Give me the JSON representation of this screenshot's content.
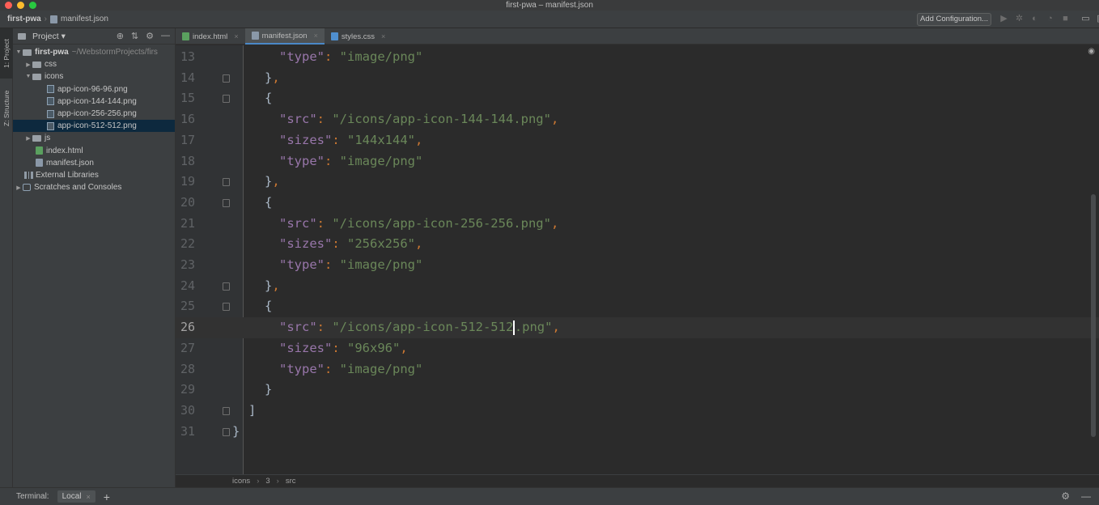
{
  "window": {
    "title": "first-pwa – manifest.json"
  },
  "nav": {
    "project": "first-pwa",
    "file": "manifest.json",
    "add_config": "Add Configuration..."
  },
  "toolstrip": {
    "project_tab": "1: Project",
    "structure_tab": "Z: Structure"
  },
  "project_panel": {
    "title": "Project",
    "root": {
      "name": "first-pwa",
      "path": "~/WebstormProjects/firs"
    },
    "css": "css",
    "icons": "icons",
    "icon_files": [
      "app-icon-96-96.png",
      "app-icon-144-144.png",
      "app-icon-256-256.png",
      "app-icon-512-512.png"
    ],
    "js": "js",
    "index": "index.html",
    "manifest": "manifest.json",
    "external_libraries": "External Libraries",
    "scratches": "Scratches and Consoles"
  },
  "tabs": [
    "index.html",
    "manifest.json",
    "styles.css"
  ],
  "editor": {
    "line_numbers": [
      "13",
      "14",
      "15",
      "16",
      "17",
      "18",
      "19",
      "20",
      "21",
      "22",
      "23",
      "24",
      "25",
      "26",
      "27",
      "28",
      "29",
      "30",
      "31"
    ],
    "l13": {
      "key": "\"type\"",
      "val": "\"image/png\""
    },
    "l16": {
      "key": "\"src\"",
      "val": "\"/icons/app-icon-144-144.png\""
    },
    "l17": {
      "key": "\"sizes\"",
      "val": "\"144x144\""
    },
    "l18": {
      "key": "\"type\"",
      "val": "\"image/png\""
    },
    "l21": {
      "key": "\"src\"",
      "val": "\"/icons/app-icon-256-256.png\""
    },
    "l22": {
      "key": "\"sizes\"",
      "val": "\"256x256\""
    },
    "l23": {
      "key": "\"type\"",
      "val": "\"image/png\""
    },
    "l26": {
      "key": "\"src\"",
      "val_a": "\"/icons/app-icon-512-512",
      "val_b": ".png\""
    },
    "l27": {
      "key": "\"sizes\"",
      "val": "\"96x96\""
    },
    "l28": {
      "key": "\"type\"",
      "val": "\"image/png\""
    },
    "breadcrumbs": [
      "icons",
      "3",
      "src"
    ]
  },
  "terminal": {
    "label": "Terminal:",
    "tab": "Local"
  }
}
